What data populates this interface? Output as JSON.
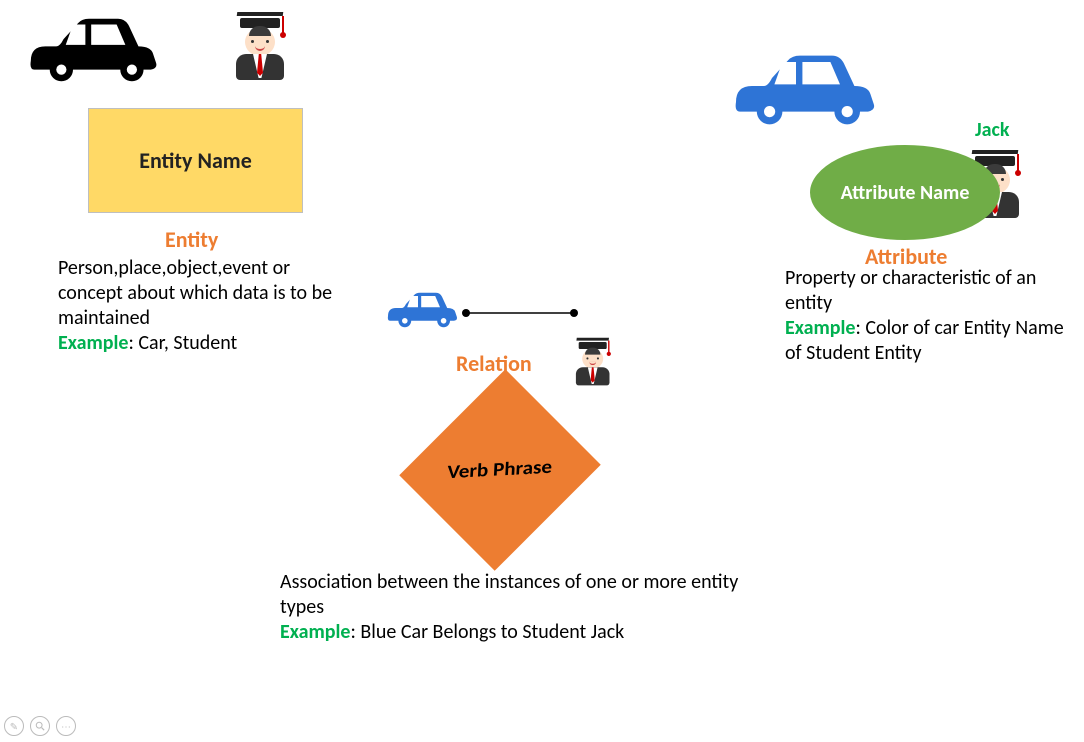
{
  "entity": {
    "box_label": "Entity Name",
    "heading": "Entity",
    "description": "Person,place,object,event or concept about which data is to be maintained",
    "example_label": "Example",
    "example_text": ": Car, Student"
  },
  "relation": {
    "heading": "Relation",
    "diamond_label": "Verb Phrase",
    "description": "Association between the instances of one or more entity types",
    "example_label": "Example",
    "example_text": ": Blue Car Belongs to Student Jack"
  },
  "attribute": {
    "heading": "Attribute",
    "ellipse_label": "Attribute Name",
    "jack_label": "Jack",
    "description": "Property or characteristic of an entity",
    "example_label": "Example",
    "example_text": ": Color of car Entity Name of Student Entity"
  }
}
